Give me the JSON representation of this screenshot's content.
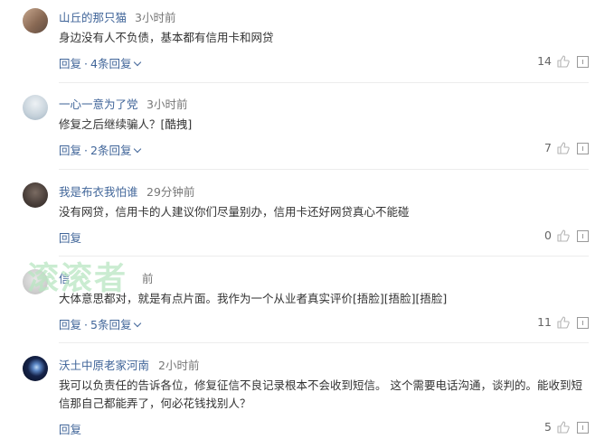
{
  "watermark": "滚滚者",
  "comments": [
    {
      "username": "山丘的那只猫",
      "time": "3小时前",
      "text": "身边没有人不负债，基本都有信用卡和网贷",
      "reply_label": "回复",
      "reply_count_label": "4条回复",
      "likes": "14"
    },
    {
      "username": "一心一意为了党",
      "time": "3小时前",
      "text": "修复之后继续骗人？[酷拽]",
      "reply_label": "回复",
      "reply_count_label": "2条回复",
      "likes": "7"
    },
    {
      "username": "我是布衣我怕谁",
      "time": "29分钟前",
      "text": "没有网贷，信用卡的人建议你们尽量别办，信用卡还好网贷真心不能碰",
      "reply_label": "回复",
      "reply_count_label": "",
      "likes": "0"
    },
    {
      "username": "信",
      "time": "前",
      "text": "大体意思都对，就是有点片面。我作为一个从业者真实评价[捂脸][捂脸][捂脸]",
      "reply_label": "回复",
      "reply_count_label": "5条回复",
      "likes": "11"
    },
    {
      "username": "沃土中原老家河南",
      "time": "2小时前",
      "text": "我可以负责任的告诉各位，修复征信不良记录根本不会收到短信。 这个需要电话沟通，谈判的。能收到短信那自己都能弄了，何必花钱找别人？",
      "reply_label": "回复",
      "reply_count_label": "",
      "likes": "5"
    }
  ]
}
